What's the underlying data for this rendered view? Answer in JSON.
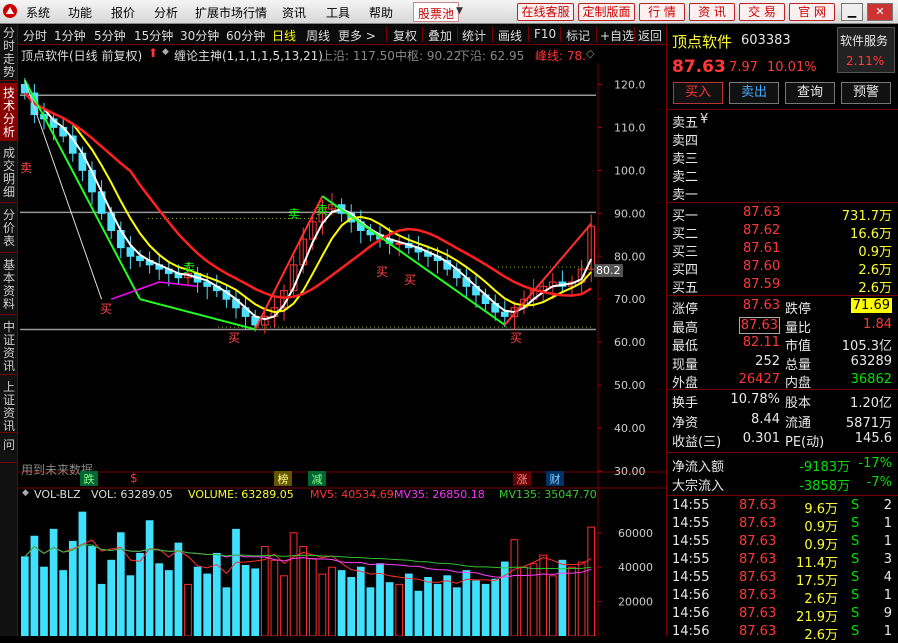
{
  "menubar": {
    "items": [
      "系统",
      "功能",
      "报价",
      "分析",
      "扩展市场行情",
      "资讯",
      "工具",
      "帮助"
    ],
    "hot": "股票池",
    "right_buttons": [
      "在线客服",
      "定制版面",
      "行 情",
      "资 讯",
      "交 易",
      "官 网"
    ]
  },
  "sidetabs": [
    "分时走势",
    "技术分析",
    "成交明细",
    "分价表",
    "基本资料",
    "中证资讯",
    "上证资讯",
    "问"
  ],
  "toolbar": {
    "periods": [
      "分时",
      "1分钟",
      "5分钟",
      "15分钟",
      "30分钟",
      "60分钟",
      "日线",
      "周线",
      "更多 >"
    ],
    "tools": [
      "复权",
      "叠加",
      "统计",
      "画线",
      "F10",
      "标记",
      "+自选",
      "返回"
    ],
    "active": "日线"
  },
  "indicator": {
    "name": "顶点软件(日线 前复权)",
    "formula": "缠论主神(1,1,1,1,5,13,21)",
    "upper": "上沿: 117.50",
    "middle": "中枢: 90.22",
    "lower": "下沿: 62.95",
    "peak": "峰线: 78."
  },
  "chart_data": [
    {
      "type": "candlestick",
      "title": "",
      "ylim": [
        30,
        125
      ],
      "y_ticks": [
        "120.0",
        "110.0",
        "100.0",
        "90.00",
        "80.00",
        "70.00",
        "60.00",
        "50.00",
        "40.00",
        "30.00"
      ],
      "lines": {
        "upper": 117.5,
        "middle": 90.22,
        "lower": 62.95
      },
      "last_price_label": "80.2",
      "closes": [
        118,
        113,
        112,
        110,
        108,
        104,
        100,
        95,
        90,
        86,
        82,
        80,
        79,
        78,
        77,
        76,
        75,
        76,
        74,
        73,
        72,
        70,
        68,
        66,
        64,
        66,
        68,
        72,
        78,
        84,
        88,
        91,
        92,
        90,
        88,
        86,
        85,
        84,
        83,
        83,
        82,
        81,
        80,
        79,
        77,
        75,
        73,
        71,
        69,
        67,
        66,
        68,
        70,
        72,
        73,
        74,
        73,
        74,
        77,
        87
      ]
    },
    {
      "type": "bar",
      "title": "",
      "ylim": [
        0,
        75000
      ],
      "y_ticks": [
        "60000",
        "40000",
        "20000"
      ],
      "values": [
        46000,
        58000,
        40000,
        62000,
        38000,
        55000,
        72000,
        52000,
        30000,
        44000,
        60000,
        35000,
        48000,
        67000,
        42000,
        38000,
        54000,
        30000,
        40000,
        36000,
        48000,
        28000,
        62000,
        41000,
        39000,
        52000,
        44000,
        35000,
        60000,
        52000,
        45000,
        36000,
        40000,
        38000,
        34000,
        40000,
        28000,
        42000,
        31000,
        30000,
        36000,
        26000,
        34000,
        30000,
        35000,
        28000,
        38000,
        32000,
        30000,
        33000,
        43000,
        56000,
        40000,
        42000,
        47000,
        35000,
        44000,
        40000,
        43000,
        63289
      ]
    }
  ],
  "events": {
    "labels": [
      "跌",
      "$",
      "榜",
      "减",
      "涨",
      "财"
    ],
    "note": "用到未来数据",
    "buy": "买",
    "sell": "卖"
  },
  "volume": {
    "name": "VOL-BLZ",
    "vol": "VOL: 63289.05",
    "volume": "VOLUME: 63289.05",
    "mv5": "MV5: 40534.69",
    "mv35": "MV35: 26850.18",
    "mv135": "MV135: 35047.70"
  },
  "stock": {
    "name": "顶点软件",
    "code": "603383",
    "service": "软件服务",
    "service_pct": "2.11%",
    "price": "87.63",
    "change": "7.97",
    "pct": "10.01%",
    "buttons": [
      "买入",
      "卖出",
      "查询",
      "预警"
    ]
  },
  "orderbook": {
    "sell": [
      {
        "label": "卖五",
        "price": "",
        "vol": ""
      },
      {
        "label": "卖四",
        "price": "",
        "vol": ""
      },
      {
        "label": "卖三",
        "price": "",
        "vol": ""
      },
      {
        "label": "卖二",
        "price": "",
        "vol": ""
      },
      {
        "label": "卖一",
        "price": "",
        "vol": ""
      }
    ],
    "currency": "¥",
    "buy": [
      {
        "label": "买一",
        "price": "87.63",
        "vol": "731.7万"
      },
      {
        "label": "买二",
        "price": "87.62",
        "vol": "16.6万"
      },
      {
        "label": "买三",
        "price": "87.61",
        "vol": "0.9万"
      },
      {
        "label": "买四",
        "price": "87.60",
        "vol": "2.6万"
      },
      {
        "label": "买五",
        "price": "87.59",
        "vol": "2.6万"
      }
    ]
  },
  "quote": [
    {
      "l1": "涨停",
      "v1": "87.63",
      "l2": "跌停",
      "v2": "71.69"
    },
    {
      "l1": "最高",
      "v1": "87.63",
      "l2": "量比",
      "v2": "1.84"
    },
    {
      "l1": "最低",
      "v1": "82.11",
      "l2": "市值",
      "v2": "105.3亿"
    },
    {
      "l1": "现量",
      "v1": "252",
      "l2": "总量",
      "v2": "63289"
    },
    {
      "l1": "外盘",
      "v1": "26427",
      "l2": "内盘",
      "v2": "36862"
    }
  ],
  "fundamentals": [
    {
      "l1": "换手",
      "v1": "10.78%",
      "l2": "股本",
      "v2": "1.20亿"
    },
    {
      "l1": "净资",
      "v1": "8.44",
      "l2": "流通",
      "v2": "5871万"
    },
    {
      "l1": "收益(三)",
      "v1": "0.301",
      "l2": "PE(动)",
      "v2": "145.6"
    }
  ],
  "flows": [
    {
      "label": "净流入额",
      "value": "-9183万",
      "pct": "-17%"
    },
    {
      "label": "大宗流入",
      "value": "-3858万",
      "pct": "-7%"
    }
  ],
  "ticks": [
    {
      "time": "14:55",
      "price": "87.63",
      "vol": "9.6万",
      "side": "S",
      "n": "2"
    },
    {
      "time": "14:55",
      "price": "87.63",
      "vol": "0.9万",
      "side": "S",
      "n": "1"
    },
    {
      "time": "14:55",
      "price": "87.63",
      "vol": "0.9万",
      "side": "S",
      "n": "1"
    },
    {
      "time": "14:55",
      "price": "87.63",
      "vol": "11.4万",
      "side": "S",
      "n": "3"
    },
    {
      "time": "14:55",
      "price": "87.63",
      "vol": "17.5万",
      "side": "S",
      "n": "4"
    },
    {
      "time": "14:56",
      "price": "87.63",
      "vol": "2.6万",
      "side": "S",
      "n": "1"
    },
    {
      "time": "14:56",
      "price": "87.63",
      "vol": "21.9万",
      "side": "S",
      "n": "9"
    },
    {
      "time": "14:56",
      "price": "87.63",
      "vol": "2.6万",
      "side": "S",
      "n": "1"
    }
  ]
}
